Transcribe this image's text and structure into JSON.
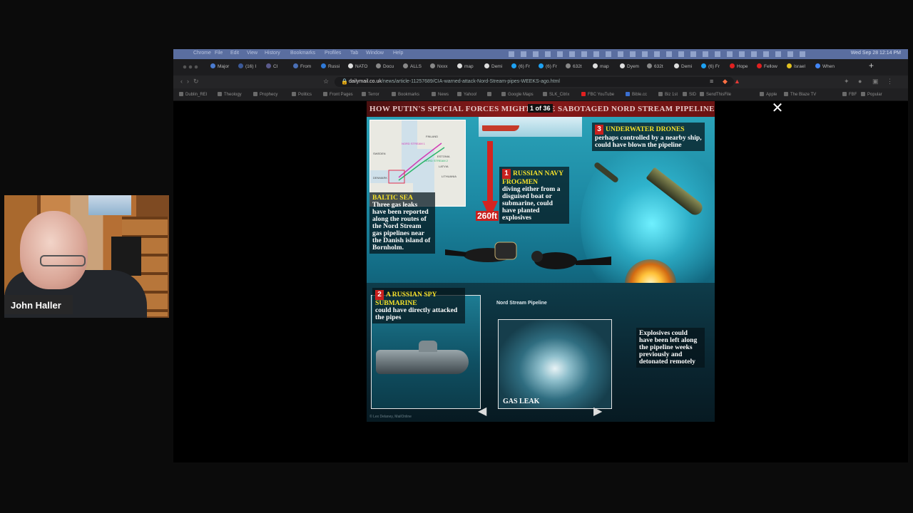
{
  "browser": {
    "menu": [
      "Chrome",
      "File",
      "Edit",
      "View",
      "History",
      "Bookmarks",
      "Profiles",
      "Tab",
      "Window",
      "Help"
    ],
    "clock": "Wed Sep 28  12:14 PM",
    "tabs": [
      "Major",
      "(16) I",
      "CI",
      "From",
      "Russi",
      "NATO",
      "Docu",
      "ALLS",
      "Nxxx",
      "map",
      "Demi",
      "(6) Fr",
      "(6) Fr",
      "632t",
      "map",
      "Dyem",
      "632t",
      "Demi",
      "(6) Fr",
      "Hope",
      "Fellow",
      "Israel",
      "When"
    ],
    "url_domain": "dailymail.co.uk",
    "url_path": "/news/article-11257689/CIA-warned-attack-Nord-Stream-pipes-WEEKS-ago.html",
    "bookmarks": [
      "Dublin_REI",
      "Theology",
      "Prophecy",
      "Politics",
      "Front Pages",
      "Terror",
      "Bookmarks",
      "News",
      "Yahoo!",
      "Google Maps",
      "SLK_Citrix",
      "FBC YouTube",
      "Bible.cc",
      "Biz 1st",
      "SID",
      "SendThisFile",
      "Apple",
      "The Blaze TV",
      "FBF",
      "Popular"
    ]
  },
  "viewer": {
    "close_icon": "close-icon",
    "counter": "1 of 36",
    "prev_icon": "arrow-left-icon",
    "next_icon": "arrow-right-icon"
  },
  "infographic": {
    "headline": "HOW PUTIN'S SPECIAL FORCES MIGHT HAVE SABOTAGED NORD STREAM PIPELINES",
    "depth": "260ft",
    "baltic_title": "BALTIC SEA",
    "baltic_text": "Three gas leaks have been reported along the routes of the Nord Stream gas pipelines near the Danish island of Bornholm.",
    "frogmen_num": "1",
    "frogmen_title": "RUSSIAN NAVY FROGMEN",
    "frogmen_text": "diving either from a disguised boat or submarine, could have planted explosives",
    "sub_num": "2",
    "sub_title": "A RUSSIAN SPY SUBMARINE",
    "sub_text": "could have directly attacked the pipes",
    "drones_num": "3",
    "drones_title": "UNDERWATER DRONES",
    "drones_text": "perhaps controlled by a nearby ship, could have blown the pipeline",
    "pipeline_label": "Nord Stream Pipeline",
    "explosives_text": "Explosives could have been left along the pipeline weeks previously and detonated remotely",
    "leak_label": "GAS LEAK",
    "credit": "© Lex Delaney, MailOnline",
    "map_labels": [
      "FINLAND",
      "SWEDEN",
      "ESTONIA",
      "LATVIA",
      "LITHUANIA",
      "DENMARK",
      "NORD STREAM 1",
      "NORD STREAM 2"
    ]
  },
  "webcam": {
    "name": "John Haller"
  }
}
